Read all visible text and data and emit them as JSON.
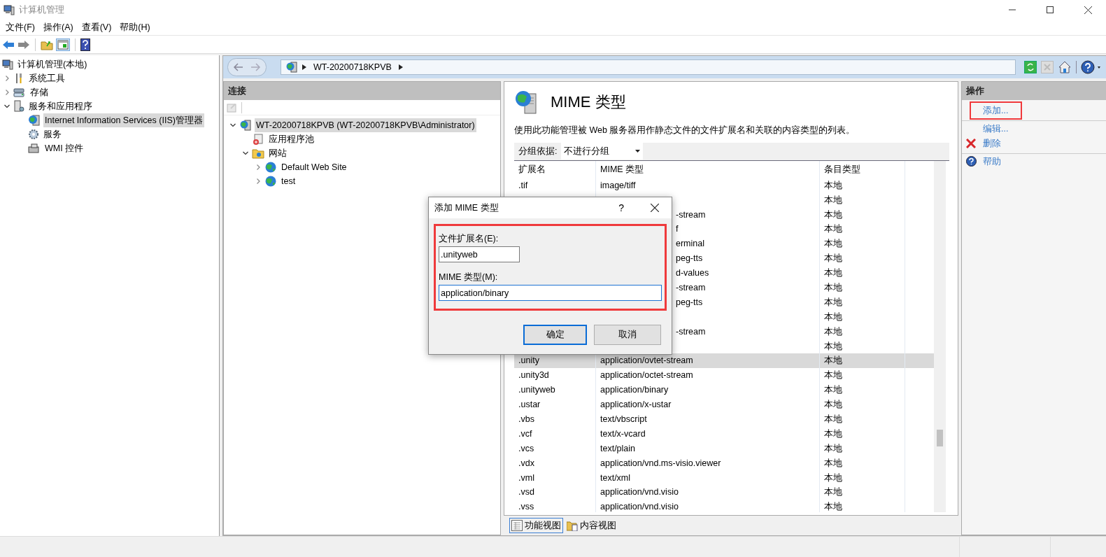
{
  "window": {
    "title": "计算机管理"
  },
  "menu": [
    "文件(F)",
    "操作(A)",
    "查看(V)",
    "帮助(H)"
  ],
  "tree": {
    "label": "计算机管理(本地)",
    "children": [
      {
        "label": "系统工具",
        "kind": "tools",
        "expanded": false
      },
      {
        "label": "存储",
        "kind": "storage",
        "expanded": false
      },
      {
        "label": "服务和应用程序",
        "kind": "apps",
        "expanded": true,
        "children": [
          {
            "label": "Internet Information Services (IIS)管理器",
            "kind": "iis",
            "selected": true
          },
          {
            "label": "服务",
            "kind": "services",
            "selected": false
          },
          {
            "label": "WMI 控件",
            "kind": "wmi",
            "selected": false
          }
        ]
      }
    ]
  },
  "address": {
    "crumbs": [
      "WT-20200718KPVB"
    ]
  },
  "connections": {
    "title": "连接",
    "tree": {
      "label": "WT-20200718KPVB (WT-20200718KPVB\\Administrator)",
      "kind": "server",
      "selected": true,
      "expanded": true,
      "children": [
        {
          "label": "应用程序池",
          "kind": "pool"
        },
        {
          "label": "网站",
          "kind": "sites",
          "expanded": true,
          "children": [
            {
              "label": "Default Web Site",
              "kind": "site",
              "expanded": false
            },
            {
              "label": "test",
              "kind": "site",
              "expanded": false
            }
          ]
        }
      ]
    }
  },
  "feature": {
    "title": "MIME 类型",
    "description": "使用此功能管理被 Web 服务器用作静态文件的文件扩展名和关联的内容类型的列表。",
    "group_by": {
      "label": "分组依据:",
      "value": "不进行分组"
    },
    "columns": [
      "扩展名",
      "MIME 类型",
      "条目类型"
    ],
    "rows": [
      {
        "kind": "row",
        "ext": ".tif",
        "mime": "image/tiff",
        "type": "本地",
        "selected": false
      },
      {
        "kind": "covered",
        "type": "本地",
        "selected": false
      },
      {
        "kind": "covered",
        "mime": "-stream",
        "type": "本地",
        "selected": false
      },
      {
        "kind": "covered",
        "mime": "f",
        "type": "本地",
        "selected": false
      },
      {
        "kind": "covered",
        "mime": "erminal",
        "type": "本地",
        "selected": false
      },
      {
        "kind": "covered",
        "mime": "peg-tts",
        "type": "本地",
        "selected": false
      },
      {
        "kind": "covered",
        "mime": "d-values",
        "type": "本地",
        "selected": false
      },
      {
        "kind": "covered",
        "mime": "-stream",
        "type": "本地",
        "selected": false
      },
      {
        "kind": "covered",
        "mime": "peg-tts",
        "type": "本地",
        "selected": false
      },
      {
        "kind": "covered",
        "type": "本地",
        "selected": false
      },
      {
        "kind": "covered",
        "mime": "-stream",
        "type": "本地",
        "selected": false
      },
      {
        "kind": "covered",
        "type": "本地",
        "selected": false
      },
      {
        "kind": "row",
        "ext": ".unity",
        "mime": "application/ovtet-stream",
        "type": "本地",
        "selected": true
      },
      {
        "kind": "row",
        "ext": ".unity3d",
        "mime": "application/octet-stream",
        "type": "本地",
        "selected": false
      },
      {
        "kind": "row",
        "ext": ".unityweb",
        "mime": "application/binary",
        "type": "本地",
        "selected": false
      },
      {
        "kind": "row",
        "ext": ".ustar",
        "mime": "application/x-ustar",
        "type": "本地",
        "selected": false
      },
      {
        "kind": "row",
        "ext": ".vbs",
        "mime": "text/vbscript",
        "type": "本地",
        "selected": false
      },
      {
        "kind": "row",
        "ext": ".vcf",
        "mime": "text/x-vcard",
        "type": "本地",
        "selected": false
      },
      {
        "kind": "row",
        "ext": ".vcs",
        "mime": "text/plain",
        "type": "本地",
        "selected": false
      },
      {
        "kind": "row",
        "ext": ".vdx",
        "mime": "application/vnd.ms-visio.viewer",
        "type": "本地",
        "selected": false
      },
      {
        "kind": "row",
        "ext": ".vml",
        "mime": "text/xml",
        "type": "本地",
        "selected": false
      },
      {
        "kind": "row",
        "ext": ".vsd",
        "mime": "application/vnd.visio",
        "type": "本地",
        "selected": false
      },
      {
        "kind": "row",
        "ext": ".vss",
        "mime": "application/vnd.visio",
        "type": "本地",
        "selected": false
      }
    ]
  },
  "view_tabs": [
    {
      "label": "功能视图",
      "selected": true
    },
    {
      "label": "内容视图",
      "selected": false
    }
  ],
  "actions": {
    "title": "操作",
    "items": [
      {
        "label": "添加...",
        "kind": "link",
        "highlighted": true
      },
      {
        "label": "编辑...",
        "kind": "link",
        "highlighted": false
      },
      {
        "label": "删除",
        "kind": "delete",
        "highlighted": false
      },
      {
        "label": "帮助",
        "kind": "help",
        "highlighted": false
      }
    ]
  },
  "dialog": {
    "title": "添加 MIME 类型",
    "help": "?",
    "highlighted": true,
    "fields": [
      {
        "label": "文件扩展名(E):",
        "value": ".unityweb",
        "focused": false
      },
      {
        "label": "MIME 类型(M):",
        "value": "application/binary",
        "focused": true
      }
    ],
    "buttons": [
      {
        "label": "确定",
        "default": true
      },
      {
        "label": "取消",
        "default": false
      }
    ]
  }
}
